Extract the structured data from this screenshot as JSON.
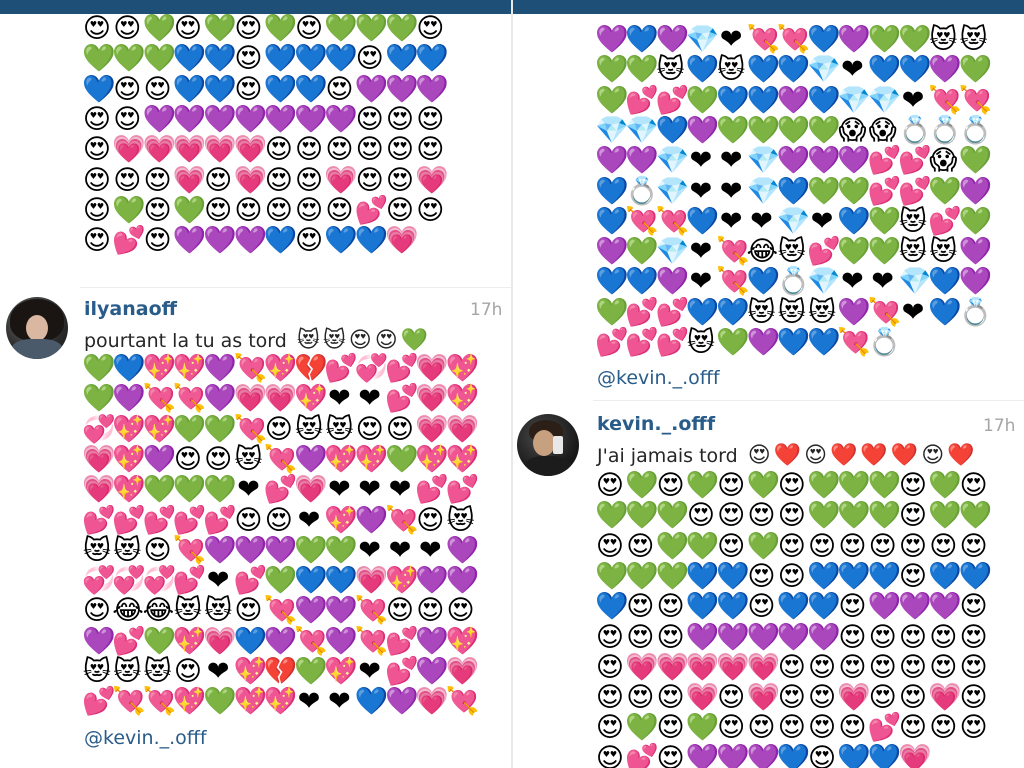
{
  "left_panel": {
    "comment": {
      "username": "ilyanaoff",
      "time": "17h",
      "text": "pourtant la tu as tord",
      "mention": "@kevin._.offf"
    }
  },
  "right_panel": {
    "mention_top": "@kevin._.offf",
    "comment": {
      "username": "kevin._.offf",
      "time": "17h",
      "text": "J'ai jamais tord"
    }
  },
  "emoji_grids": {
    "left_top": [
      "😍😍💚😍💚😍💚😍💚💚💚😍",
      "💚💚💚💙💙😍💙💙💙😍💙💙",
      "💙😍😍💙💙😍💙💙😍💜💜💜",
      "😍😍💜💜💜💜💜💜💜😍😍😍",
      "😍💗💗💗💗💗😍😍😍😍😍😍",
      "😍😍😍💗😍💗😍😍💗😍😍💗",
      "😍💚😍💚😍😍😍😍😍💕😍😍",
      "😍💕😍💜💜💜💙😍💙💙💗"
    ],
    "left_bottom": [
      "💚💙💖💖💜💘💖💔💕💞💕💗💖",
      "💚💜💘💘💜💗💗💖❤️❤️💕💗💖",
      "💞💖💖💚💚💘😍😻😻😍😍💗💗",
      "💗💖💜😍😍😻💘💜💖💖💚💖💖",
      "💗💖💚💚💚❤️💕💗❤️❤️❤️💕💕",
      "💕💕💕💕💕😍😍❤️💖💜💘😍😻",
      "😻😻😍💘💜💜💜💚💚❤️❤️❤️💜",
      "💞💞💞💕❤️💕💚💙💙💗💖💜💜",
      "😍😂😂😻😻😍💘💜💜💘😍😍😍",
      "💜💕💚💖💗💙💜💘💜💘💕💜💖",
      "😻😻😻😍❤️💖💔💚💖❤️💕💜💗",
      "💕💘💘💖💚💖💖❤️❤️💙💜💗💘"
    ],
    "right_top": [
      "💜💙💜💎❤️💘💘💙💜💚💚😻😻",
      "💚💚😻💙😻💙💙💎❤️💙💙💜💚",
      "💚💕💕💚💙💙💜💙💎💎❤️💘💘",
      "💎💎💙💜💚💚💚💚😱😱💍💍💍",
      "💜💜💎❤️❤️💎💜💜💜💕💕😱💚",
      "💙💍💎❤️❤️💎💙💚💚💕💕💚💜",
      "💙💘💘💙❤️❤️💎❤️💙💚😻💕💚",
      "💜💚💎❤️💘😂😻💕💚💚😻😻💜",
      "💙💙💜❤️💘💙💍💎❤️❤️💎💙💜",
      "💚💕💕💙💙😻😻😻💜💘❤️💙💍",
      "💕💕💕😻💚💜💙💙💘💍"
    ],
    "right_bottom": [
      "😍💚😍💚😍💚😍💚💚💚😍💚😍",
      "💚💚💚😍😍😍😍💚💚💚😍💚💚",
      "😍😍💚💚😍💚😍😍😍😍😍😍😍",
      "💚💚💚💙💙😍😍💙💙💙😍💙💙",
      "💙😍😍💙💙😍💙💙😍💜💜💜😍",
      "😍😍😍💜💜💜💜💜😍😍😍😍😍",
      "😍💗💗💗💗💗😍😍😍😍😍😍😍",
      "😍😍😍💗😍💗😍😍💗😍😍💗😍",
      "😍💚😍💚😍😍😍😍😍💕😍😍😍",
      "😍💕😍💜💜💜💙😍💙💙💗"
    ]
  },
  "inline_emojis": {
    "left_comment": "😻😻😍😍💚",
    "right_comment": "😍❤️😍❤️❤️❤️😍❤️"
  }
}
